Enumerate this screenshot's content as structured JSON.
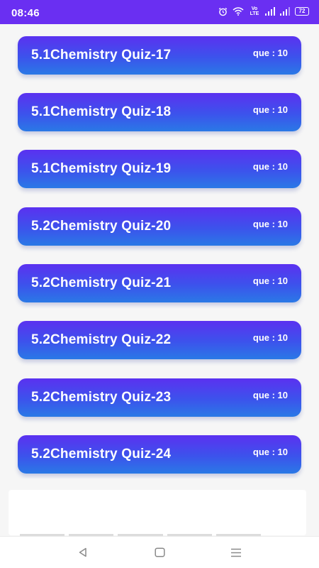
{
  "status_bar": {
    "time": "08:46",
    "battery": "72",
    "network_label": "Vo LTE",
    "icons": [
      "alarm-icon",
      "wifi-icon",
      "volte-icon",
      "signal-icon",
      "signal-icon",
      "battery-icon"
    ]
  },
  "quizzes": [
    {
      "title": "5.1Chemistry Quiz-17",
      "count": "que : 10"
    },
    {
      "title": "5.1Chemistry Quiz-18",
      "count": "que : 10"
    },
    {
      "title": "5.1Chemistry Quiz-19",
      "count": "que : 10"
    },
    {
      "title": "5.2Chemistry Quiz-20",
      "count": "que : 10"
    },
    {
      "title": "5.2Chemistry Quiz-21",
      "count": "que : 10"
    },
    {
      "title": "5.2Chemistry Quiz-22",
      "count": "que : 10"
    },
    {
      "title": "5.2Chemistry Quiz-23",
      "count": "que : 10"
    },
    {
      "title": "5.2Chemistry Quiz-24",
      "count": "que : 10"
    }
  ],
  "colors": {
    "status_bar": "#6a2ff2",
    "card_top": "#5b31f0",
    "card_bottom": "#2a79e6",
    "background": "#f6f6f6"
  },
  "nav_bar": {
    "icons": [
      "back-icon",
      "home-icon",
      "recents-icon"
    ]
  }
}
